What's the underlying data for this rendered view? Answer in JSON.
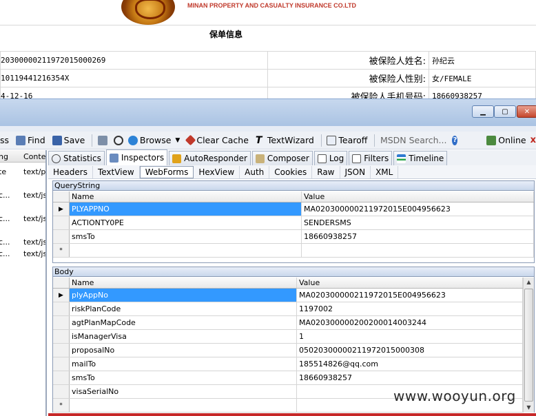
{
  "web": {
    "company": "MINAN PROPERTY AND CASUALTY INSURANCE CO.LTD",
    "title": "保单信息",
    "rows": [
      {
        "value1": "20300000211972015000269",
        "label": "被保险人姓名:",
        "value2": "孙纪云"
      },
      {
        "value1": "10119441216354X",
        "label": "被保险人性别:",
        "value2": "女/FEMALE"
      },
      {
        "value1": "4-12-16",
        "label": "被保险人手机号码:",
        "value2": "18660938257"
      }
    ]
  },
  "toolbar": {
    "items": [
      "ss",
      "Find",
      "Save",
      "Browse",
      "Clear Cache",
      "TextWizard",
      "Tearoff"
    ],
    "search_placeholder": "MSDN Search...",
    "online": "Online",
    "close": "x"
  },
  "sessions": {
    "headers": [
      "ng",
      "Conter"
    ],
    "rows": [
      {
        "a": "te",
        "b": "text/p"
      },
      {
        "a": "c...",
        "b": "text/js"
      },
      {
        "a": "c...",
        "b": "text/js"
      },
      {
        "a": "c...",
        "b": "text/js"
      },
      {
        "a": "c...",
        "b": "text/js"
      }
    ]
  },
  "inspector_tabs": [
    "Statistics",
    "Inspectors",
    "AutoResponder",
    "Composer",
    "Log",
    "Filters",
    "Timeline"
  ],
  "request_tabs": [
    "Headers",
    "TextView",
    "WebForms",
    "HexView",
    "Auth",
    "Cookies",
    "Raw",
    "JSON",
    "XML"
  ],
  "querystring": {
    "title": "QueryString",
    "col_name": "Name",
    "col_value": "Value",
    "rows": [
      {
        "name": "PLYAPPNO",
        "value": "MA020300000211972015E004956623"
      },
      {
        "name": "ACTIONTY0PE",
        "value": "SENDERSMS"
      },
      {
        "name": "smsTo",
        "value": "18660938257"
      }
    ],
    "new_row_marker": "*"
  },
  "body": {
    "title": "Body",
    "col_name": "Name",
    "col_value": "Value",
    "rows": [
      {
        "name": "plyAppNo",
        "value": "MA020300000211972015E004956623"
      },
      {
        "name": "riskPlanCode",
        "value": "1197002"
      },
      {
        "name": "agtPlanMapCode",
        "value": "MA020300000200200014003244"
      },
      {
        "name": "isManagerVisa",
        "value": "1"
      },
      {
        "name": "proposalNo",
        "value": "050203000002119720150003​08"
      },
      {
        "name": "mailTo",
        "value": "185514826@qq.com"
      },
      {
        "name": "smsTo",
        "value": "18660938257"
      },
      {
        "name": "visaSerialNo",
        "value": ""
      }
    ],
    "new_row_marker": "*"
  },
  "watermark": "www.wooyun.org",
  "colors": {
    "selection": "#3399ff",
    "titlebar": "#aac3e3",
    "accent_red": "#c62828"
  }
}
